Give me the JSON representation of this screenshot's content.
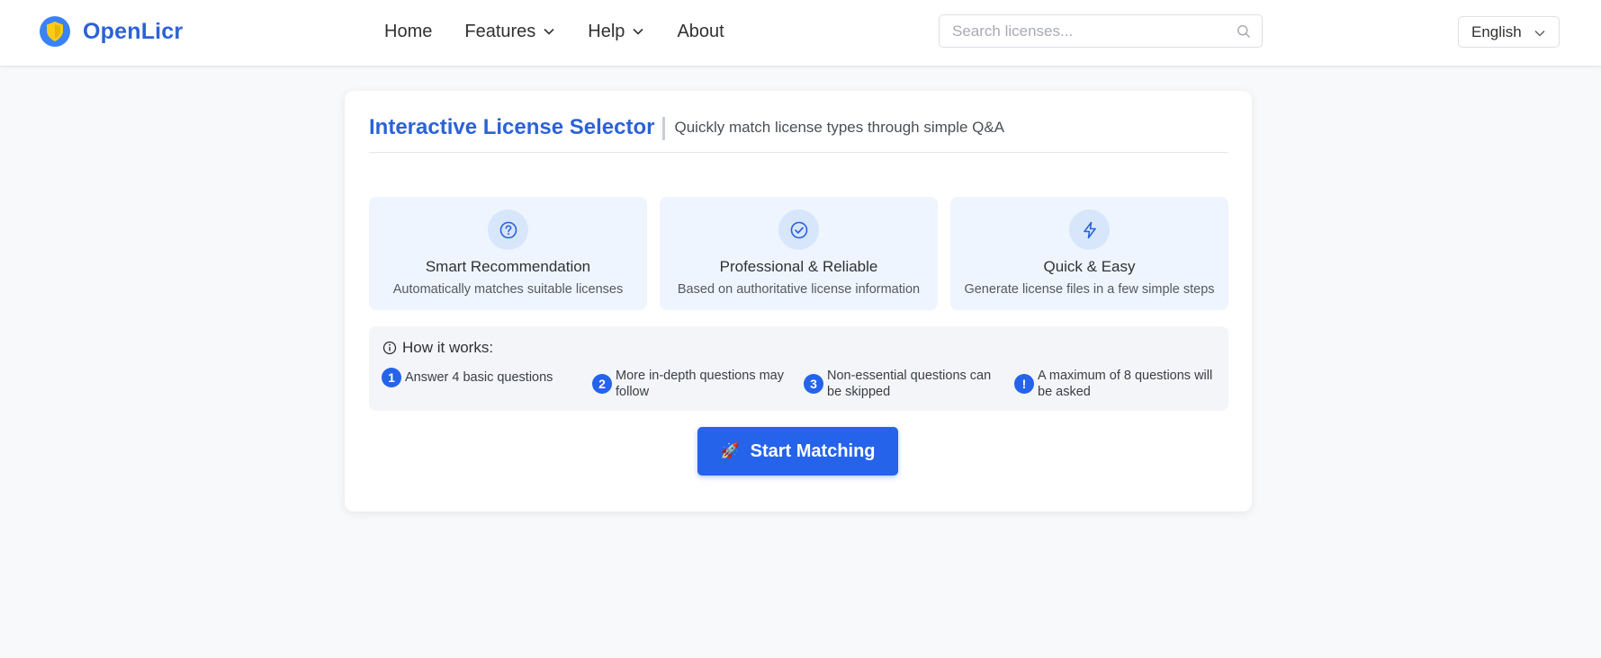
{
  "app": {
    "logo_text": "OpenLicr",
    "logo_colors": {
      "shield": "#3b82f6",
      "inner": "#facc15"
    }
  },
  "nav": {
    "items": [
      {
        "label": "Home",
        "has_dropdown": false
      },
      {
        "label": "Features",
        "has_dropdown": true
      },
      {
        "label": "Help",
        "has_dropdown": true
      },
      {
        "label": "About",
        "has_dropdown": false
      }
    ]
  },
  "search": {
    "placeholder": "Search licenses...",
    "value": "",
    "icon": "search-icon"
  },
  "language": {
    "selected": "English",
    "icon": "chevron-down-icon"
  },
  "selector": {
    "title": "Interactive License Selector",
    "subtitle": "Quickly match license types through simple Q&A",
    "features": [
      {
        "icon": "question-circle-icon",
        "title": "Smart Recommendation",
        "desc": "Automatically matches suitable licenses"
      },
      {
        "icon": "check-circle-icon",
        "title": "Professional & Reliable",
        "desc": "Based on authoritative license information"
      },
      {
        "icon": "lightning-icon",
        "title": "Quick & Easy",
        "desc": "Generate license files in a few simple steps"
      }
    ],
    "how": {
      "title": "How it works:",
      "icon": "info-circle-icon",
      "steps": [
        {
          "badge": "1",
          "text": "Answer 4 basic questions"
        },
        {
          "badge": "2",
          "text": "More in-depth questions may follow"
        },
        {
          "badge": "3",
          "text": "Non-essential questions can be skipped"
        },
        {
          "badge": "!",
          "text": "A maximum of 8 questions will be asked"
        }
      ]
    },
    "start_button": {
      "label": "Start Matching",
      "icon": "rocket-icon",
      "glyph": "🚀"
    }
  },
  "colors": {
    "brand": "#2c62d6",
    "accent": "#2563eb",
    "feature_bg": "#eef5ff",
    "page_bg": "#f8f9fa"
  }
}
